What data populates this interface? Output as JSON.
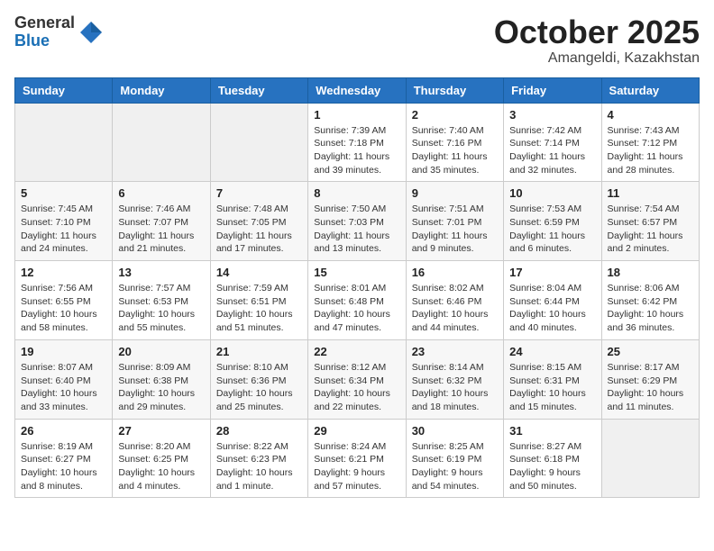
{
  "header": {
    "logo_general": "General",
    "logo_blue": "Blue",
    "month": "October 2025",
    "location": "Amangeldi, Kazakhstan"
  },
  "weekdays": [
    "Sunday",
    "Monday",
    "Tuesday",
    "Wednesday",
    "Thursday",
    "Friday",
    "Saturday"
  ],
  "weeks": [
    [
      {
        "day": "",
        "info": ""
      },
      {
        "day": "",
        "info": ""
      },
      {
        "day": "",
        "info": ""
      },
      {
        "day": "1",
        "info": "Sunrise: 7:39 AM\nSunset: 7:18 PM\nDaylight: 11 hours\nand 39 minutes."
      },
      {
        "day": "2",
        "info": "Sunrise: 7:40 AM\nSunset: 7:16 PM\nDaylight: 11 hours\nand 35 minutes."
      },
      {
        "day": "3",
        "info": "Sunrise: 7:42 AM\nSunset: 7:14 PM\nDaylight: 11 hours\nand 32 minutes."
      },
      {
        "day": "4",
        "info": "Sunrise: 7:43 AM\nSunset: 7:12 PM\nDaylight: 11 hours\nand 28 minutes."
      }
    ],
    [
      {
        "day": "5",
        "info": "Sunrise: 7:45 AM\nSunset: 7:10 PM\nDaylight: 11 hours\nand 24 minutes."
      },
      {
        "day": "6",
        "info": "Sunrise: 7:46 AM\nSunset: 7:07 PM\nDaylight: 11 hours\nand 21 minutes."
      },
      {
        "day": "7",
        "info": "Sunrise: 7:48 AM\nSunset: 7:05 PM\nDaylight: 11 hours\nand 17 minutes."
      },
      {
        "day": "8",
        "info": "Sunrise: 7:50 AM\nSunset: 7:03 PM\nDaylight: 11 hours\nand 13 minutes."
      },
      {
        "day": "9",
        "info": "Sunrise: 7:51 AM\nSunset: 7:01 PM\nDaylight: 11 hours\nand 9 minutes."
      },
      {
        "day": "10",
        "info": "Sunrise: 7:53 AM\nSunset: 6:59 PM\nDaylight: 11 hours\nand 6 minutes."
      },
      {
        "day": "11",
        "info": "Sunrise: 7:54 AM\nSunset: 6:57 PM\nDaylight: 11 hours\nand 2 minutes."
      }
    ],
    [
      {
        "day": "12",
        "info": "Sunrise: 7:56 AM\nSunset: 6:55 PM\nDaylight: 10 hours\nand 58 minutes."
      },
      {
        "day": "13",
        "info": "Sunrise: 7:57 AM\nSunset: 6:53 PM\nDaylight: 10 hours\nand 55 minutes."
      },
      {
        "day": "14",
        "info": "Sunrise: 7:59 AM\nSunset: 6:51 PM\nDaylight: 10 hours\nand 51 minutes."
      },
      {
        "day": "15",
        "info": "Sunrise: 8:01 AM\nSunset: 6:48 PM\nDaylight: 10 hours\nand 47 minutes."
      },
      {
        "day": "16",
        "info": "Sunrise: 8:02 AM\nSunset: 6:46 PM\nDaylight: 10 hours\nand 44 minutes."
      },
      {
        "day": "17",
        "info": "Sunrise: 8:04 AM\nSunset: 6:44 PM\nDaylight: 10 hours\nand 40 minutes."
      },
      {
        "day": "18",
        "info": "Sunrise: 8:06 AM\nSunset: 6:42 PM\nDaylight: 10 hours\nand 36 minutes."
      }
    ],
    [
      {
        "day": "19",
        "info": "Sunrise: 8:07 AM\nSunset: 6:40 PM\nDaylight: 10 hours\nand 33 minutes."
      },
      {
        "day": "20",
        "info": "Sunrise: 8:09 AM\nSunset: 6:38 PM\nDaylight: 10 hours\nand 29 minutes."
      },
      {
        "day": "21",
        "info": "Sunrise: 8:10 AM\nSunset: 6:36 PM\nDaylight: 10 hours\nand 25 minutes."
      },
      {
        "day": "22",
        "info": "Sunrise: 8:12 AM\nSunset: 6:34 PM\nDaylight: 10 hours\nand 22 minutes."
      },
      {
        "day": "23",
        "info": "Sunrise: 8:14 AM\nSunset: 6:32 PM\nDaylight: 10 hours\nand 18 minutes."
      },
      {
        "day": "24",
        "info": "Sunrise: 8:15 AM\nSunset: 6:31 PM\nDaylight: 10 hours\nand 15 minutes."
      },
      {
        "day": "25",
        "info": "Sunrise: 8:17 AM\nSunset: 6:29 PM\nDaylight: 10 hours\nand 11 minutes."
      }
    ],
    [
      {
        "day": "26",
        "info": "Sunrise: 8:19 AM\nSunset: 6:27 PM\nDaylight: 10 hours\nand 8 minutes."
      },
      {
        "day": "27",
        "info": "Sunrise: 8:20 AM\nSunset: 6:25 PM\nDaylight: 10 hours\nand 4 minutes."
      },
      {
        "day": "28",
        "info": "Sunrise: 8:22 AM\nSunset: 6:23 PM\nDaylight: 10 hours\nand 1 minute."
      },
      {
        "day": "29",
        "info": "Sunrise: 8:24 AM\nSunset: 6:21 PM\nDaylight: 9 hours\nand 57 minutes."
      },
      {
        "day": "30",
        "info": "Sunrise: 8:25 AM\nSunset: 6:19 PM\nDaylight: 9 hours\nand 54 minutes."
      },
      {
        "day": "31",
        "info": "Sunrise: 8:27 AM\nSunset: 6:18 PM\nDaylight: 9 hours\nand 50 minutes."
      },
      {
        "day": "",
        "info": ""
      }
    ]
  ]
}
